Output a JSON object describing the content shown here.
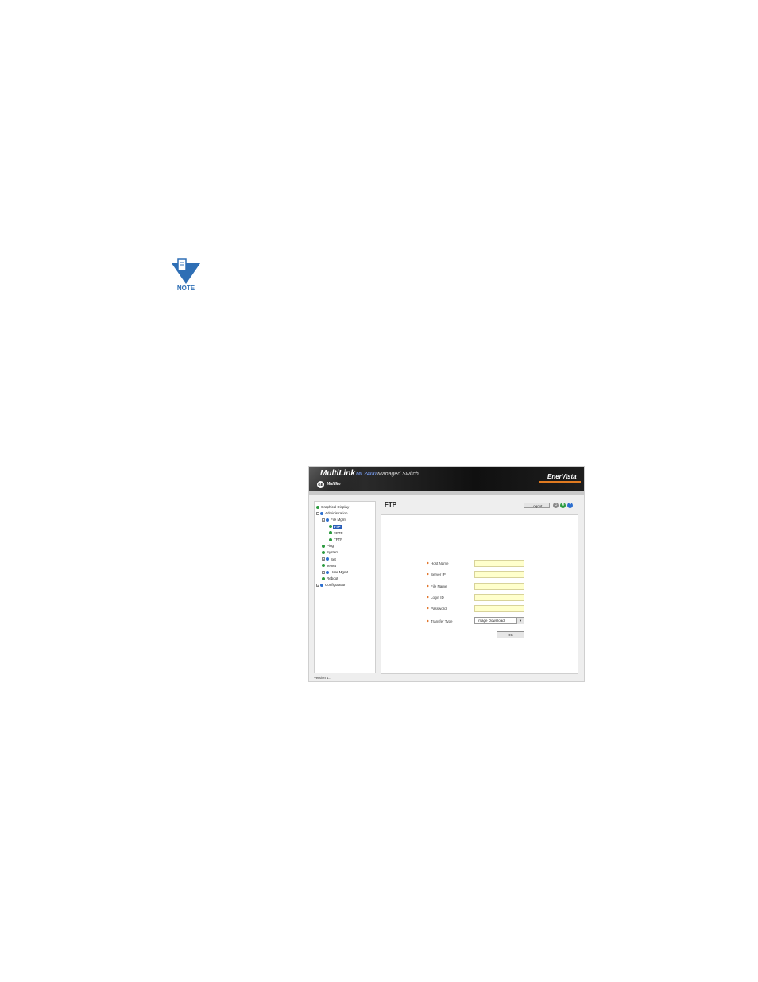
{
  "note": {
    "label": "NOTE",
    "icon": "note-icon",
    "color": "#2f6fb5"
  },
  "header": {
    "brand": "MultiLink",
    "model": "ML2400",
    "product": "Managed Switch",
    "logo": "GE",
    "company": "Multilin",
    "partner": "EnerVista"
  },
  "sidebar": {
    "items": [
      {
        "label": "Graphical Display",
        "expander": "",
        "bullet": "green",
        "level": 0
      },
      {
        "label": "Administration",
        "expander": "−",
        "bullet": "blue",
        "level": 0
      },
      {
        "label": "File Mgmt",
        "expander": "−",
        "bullet": "blue",
        "level": 1
      },
      {
        "label": "FTP",
        "expander": "",
        "bullet": "green",
        "level": 2,
        "selected": true
      },
      {
        "label": "SFTP",
        "expander": "",
        "bullet": "green",
        "level": 2
      },
      {
        "label": "TFTP",
        "expander": "",
        "bullet": "green",
        "level": 2
      },
      {
        "label": "Ping",
        "expander": "",
        "bullet": "green",
        "level": 1
      },
      {
        "label": "System",
        "expander": "",
        "bullet": "green",
        "level": 1
      },
      {
        "label": "Set",
        "expander": "+",
        "bullet": "blue",
        "level": 1
      },
      {
        "label": "Telnet",
        "expander": "",
        "bullet": "green",
        "level": 1
      },
      {
        "label": "User Mgmt",
        "expander": "+",
        "bullet": "blue",
        "level": 1
      },
      {
        "label": "Reboot",
        "expander": "",
        "bullet": "green",
        "level": 1
      },
      {
        "label": "Configuration",
        "expander": "+",
        "bullet": "blue",
        "level": 0
      }
    ]
  },
  "main": {
    "title": "FTP",
    "logout_label": "Logout",
    "icons": [
      {
        "name": "user-icon",
        "glyph": "☺",
        "color": "#8a8a8a"
      },
      {
        "name": "refresh-icon",
        "glyph": "↻",
        "color": "#2b9a3e"
      },
      {
        "name": "help-icon",
        "glyph": "?",
        "color": "#2d6fcf"
      }
    ],
    "fields": [
      {
        "label": "Host Name",
        "value": ""
      },
      {
        "label": "Server IP",
        "value": ""
      },
      {
        "label": "File Name",
        "value": ""
      },
      {
        "label": "Login ID",
        "value": ""
      },
      {
        "label": "Password",
        "value": ""
      }
    ],
    "transfer_type_label": "Transfer Type",
    "transfer_type_value": "Image Download",
    "ok_label": "OK"
  },
  "footer": {
    "version": "Version 1.7"
  },
  "colors": {
    "accent": "#2b5fb8",
    "input_bg": "#ffffcc",
    "arrow": "#e06b1b"
  }
}
